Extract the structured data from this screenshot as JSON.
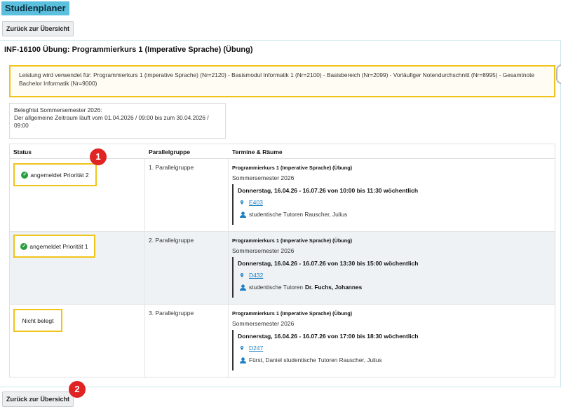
{
  "app": {
    "title": "Studienplaner"
  },
  "nav": {
    "back_label": "Zurück zur Übersicht"
  },
  "course": {
    "title": "INF-16100 Übung: Programmierkurs 1 (Imperative Sprache) (Übung)"
  },
  "usage_info": "Leistung wird verwendet für: Programmierkurs 1 (imperative Sprache) (Nr=2120) - Basismodul Informatik 1 (Nr=2100) - Basisbereich (Nr=2099) - Vorläufiger Notendurchschnitt (Nr=8995) - Gesamtnote Bachelor Informatik (Nr=9000)",
  "deadline": {
    "line1": "Belegfrist Sommersemester 2026:",
    "line2": "Der allgemeine Zeitraum läuft vom 01.04.2026 / 09:00 bis zum 30.04.2026 / 09:00"
  },
  "table": {
    "headers": {
      "status": "Status",
      "group": "Parallelgruppe",
      "appointments": "Termine & Räume"
    },
    "rows": [
      {
        "status": "angemeldet Priorität 2",
        "status_icon": "check-circle-icon",
        "group": "1. Parallelgruppe",
        "course_name": "Programmierkurs 1 (Imperative Sprache) (Übung)",
        "semester": "Sommersemester 2026",
        "time": "Donnerstag, 16.04.26 - 16.07.26 von 10:00 bis 11:30 wöchentlich",
        "room": "E403",
        "person_prefix": "studentische Tutoren Rauscher, Julius",
        "person_bold": ""
      },
      {
        "status": "angemeldet Priorität 1",
        "status_icon": "check-circle-icon",
        "group": "2. Parallelgruppe",
        "course_name": "Programmierkurs 1 (Imperative Sprache) (Übung)",
        "semester": "Sommersemester 2026",
        "time": "Donnerstag, 16.04.26 - 16.07.26 von 13:30 bis 15:00 wöchentlich",
        "room": "D432",
        "person_prefix": "studentische Tutoren",
        "person_bold": "Dr. Fuchs, Johannes"
      },
      {
        "status": "Nicht belegt",
        "status_icon": "",
        "group": "3. Parallelgruppe",
        "course_name": "Programmierkurs 1 (Imperative Sprache) (Übung)",
        "semester": "Sommersemester 2026",
        "time": "Donnerstag, 16.04.26 - 16.07.26 von 17:00 bis 18:30 wöchentlich",
        "room": "D247",
        "person_prefix": "Fürst, Daniel studentische Tutoren Rauscher, Julius",
        "person_bold": ""
      }
    ]
  },
  "markers": [
    "1",
    "2"
  ],
  "colors": {
    "accent": "#5bc0de",
    "highlight": "#f0c419",
    "success": "#2a9d3f",
    "link": "#1d7fc2",
    "marker": "#e02424"
  }
}
